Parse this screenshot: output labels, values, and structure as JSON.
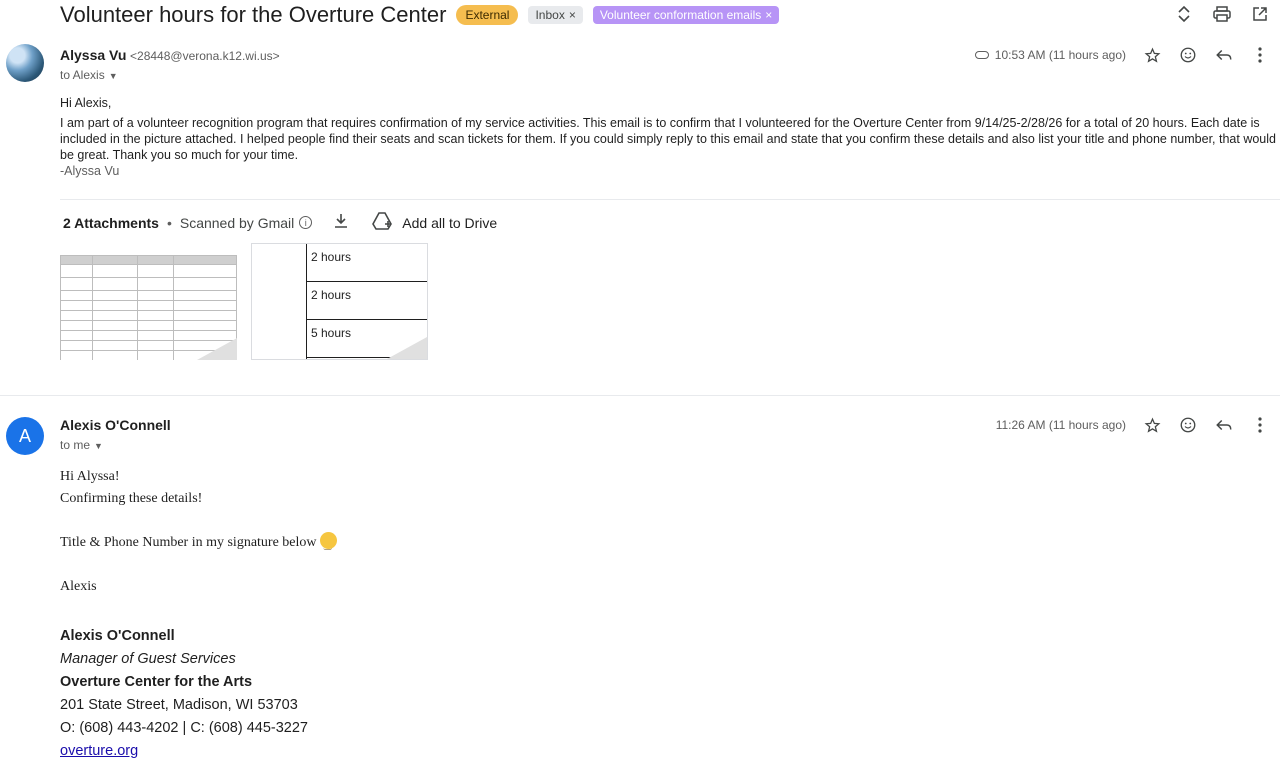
{
  "thread": {
    "subject": "Volunteer hours for the Overture Center",
    "labels": {
      "external": "External",
      "inbox": "Inbox",
      "volunteer": "Volunteer conformation emails"
    },
    "chip_remove": "×"
  },
  "toolbar": {
    "collapse_icon": "⌃⌄",
    "print_icon": "🖶",
    "open_icon": "↗"
  },
  "message1": {
    "sender_name": "Alyssa Vu",
    "sender_email": "<28448@verona.k12.wi.us>",
    "to": "to Alexis",
    "timestamp": "10:53 AM (11 hours ago)",
    "greeting": "Hi Alexis,",
    "body": "I am part of a volunteer recognition program that requires confirmation of my service activities. This email is to confirm that I volunteered for the Overture Center from 9/14/25-2/28/26 for a total of 20 hours. Each date is included in the picture attached. I helped people find their seats and scan tickets for them. If you could simply reply to this email and state that you confirm these details and also list your title and phone number, that would be great. Thank you so much for your time.",
    "signoff": "-Alyssa Vu"
  },
  "attachments": {
    "count_label": "2 Attachments",
    "scanned": "Scanned by Gmail",
    "add_to_drive": "Add all to Drive",
    "thumb2_hours": [
      "2 hours",
      "2 hours",
      "5 hours"
    ]
  },
  "message2": {
    "sender_name": "Alexis O'Connell",
    "avatar_letter": "A",
    "to": "to me",
    "timestamp": "11:26 AM (11 hours ago)",
    "line1": "Hi Alyssa!",
    "line2": "Confirming these details!",
    "line3": "Title & Phone Number in my signature below",
    "line4": "Alexis"
  },
  "signature": {
    "name": "Alexis O'Connell",
    "title": "Manager of Guest Services",
    "org": "Overture Center for the Arts",
    "address": "201 State Street, Madison, WI 53703",
    "phones": "O: (608) 443-4202 | C: (608) 445-3227",
    "website": "overture.org"
  },
  "colors": {
    "external_chip": "#f5bd4f",
    "volunteer_chip": "#b794f6",
    "avatar_blue": "#1a73e8",
    "link": "#1a0dab"
  }
}
